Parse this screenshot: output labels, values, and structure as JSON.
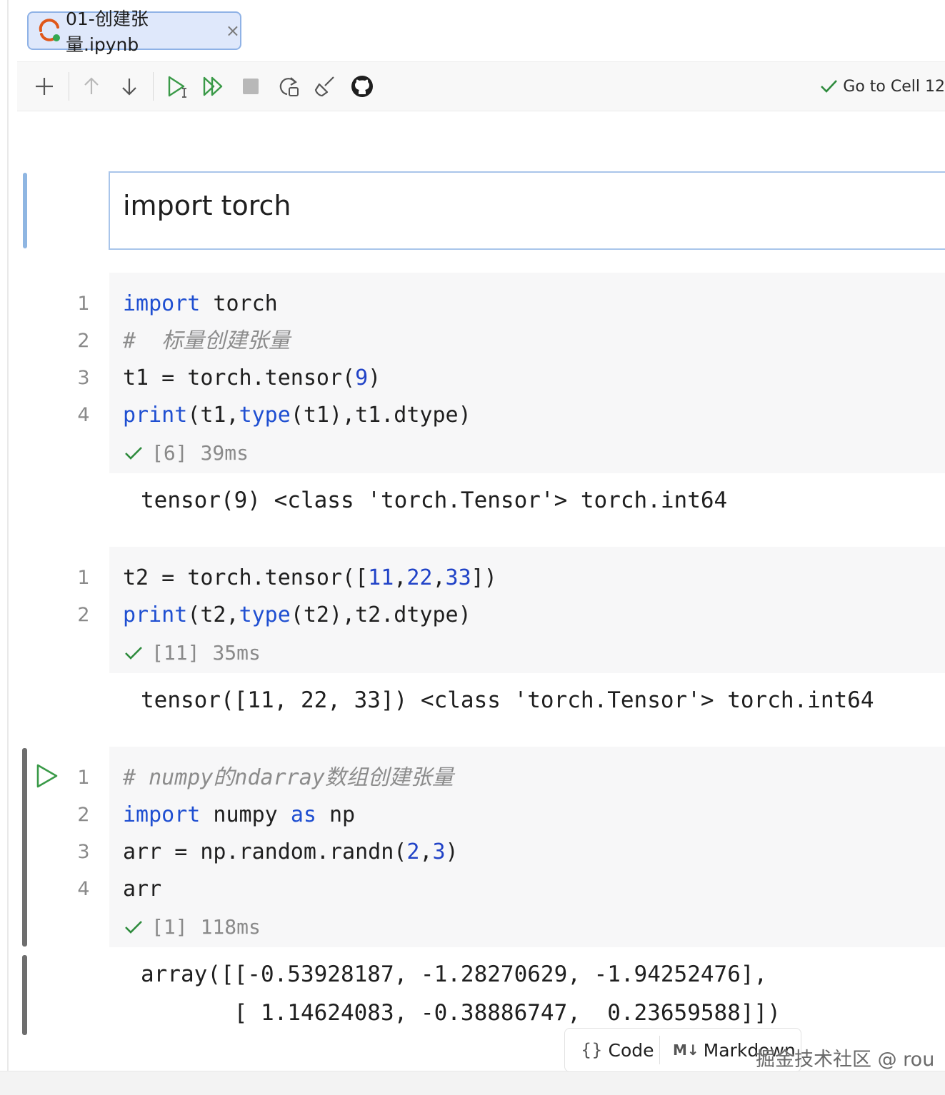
{
  "tab": {
    "title": "01-创建张量.ipynb",
    "close_glyph": "×"
  },
  "toolbar": {
    "goto_label": "Go to Cell 12"
  },
  "markdown_cell": {
    "text": "import torch"
  },
  "cells": [
    {
      "line_numbers": [
        "1",
        "2",
        "3",
        "4"
      ],
      "status": {
        "count": "[6]",
        "time": "39ms"
      },
      "output": [
        "tensor(9) <class 'torch.Tensor'> torch.int64"
      ]
    },
    {
      "line_numbers": [
        "1",
        "2"
      ],
      "status": {
        "count": "[11]",
        "time": "35ms"
      },
      "output": [
        "tensor([11, 22, 33]) <class 'torch.Tensor'> torch.int64"
      ]
    },
    {
      "line_numbers": [
        "1",
        "2",
        "3",
        "4"
      ],
      "status": {
        "count": "[1]",
        "time": "118ms"
      },
      "output": [
        "array([[-0.53928187, -1.28270629, -1.94252476],",
        "       [ 1.14624083, -0.38886747,  0.23659588]])"
      ]
    }
  ],
  "code_tokens": {
    "c1_l1_kw": "import",
    "c1_l1_rest": " torch",
    "c1_l2": "#  标量创建张量",
    "c1_l3_a": "t1 = torch.tensor(",
    "c1_l3_num": "9",
    "c1_l3_b": ")",
    "c1_l4_kw": "print",
    "c1_l4_a": "(t1,",
    "c1_l4_kw2": "type",
    "c1_l4_b": "(t1),t1.dtype)",
    "c2_l1_a": "t2 = torch.tensor([",
    "c2_l1_n1": "11",
    "c2_l1_c1": ",",
    "c2_l1_n2": "22",
    "c2_l1_c2": ",",
    "c2_l1_n3": "33",
    "c2_l1_b": "])",
    "c2_l2_kw": "print",
    "c2_l2_a": "(t2,",
    "c2_l2_kw2": "type",
    "c2_l2_b": "(t2),t2.dtype)",
    "c3_l1": "# numpy的ndarray数组创建张量",
    "c3_l2_kw": "import",
    "c3_l2_a": " numpy ",
    "c3_l2_kw2": "as",
    "c3_l2_b": " np",
    "c3_l3_a": "arr = np.random.randn(",
    "c3_l3_n1": "2",
    "c3_l3_c": ",",
    "c3_l3_n2": "3",
    "c3_l3_b": ")",
    "c3_l4": "arr"
  },
  "add_cell": {
    "code_label": "Code",
    "markdown_label": "Markdown",
    "markdown_prefix": "M↓"
  },
  "watermark": "掘金技术社区 @ rou",
  "colors": {
    "keyword": "#1f4fd1",
    "number": "#2143c7",
    "comment": "#8c8c8c",
    "success": "#2e8b3d",
    "tab_bg": "#dfe8fb"
  }
}
